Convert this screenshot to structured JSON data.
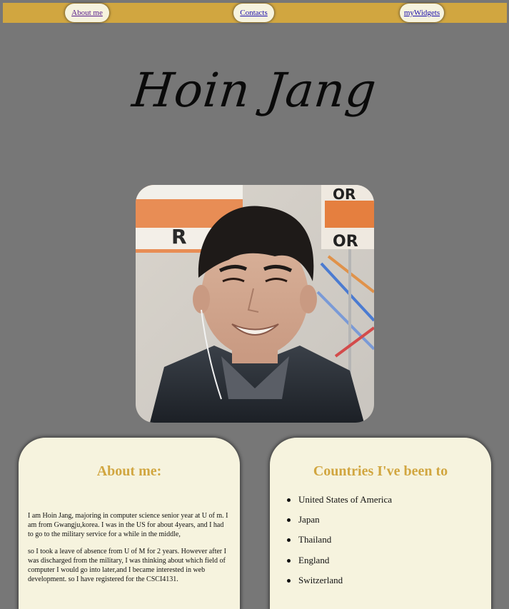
{
  "nav": {
    "about": "About me",
    "contacts": "Contacts",
    "widgets": "myWidgets"
  },
  "header": {
    "name": "Hoin Jang"
  },
  "about": {
    "heading": "About me:",
    "paragraphs": [
      "I am Hoin Jang, majoring in computer science senior year at U of m. I am from Gwangju,korea. I was in the US for about 4years, and I had to go to the military service for a while in the middle,",
      "so I took a leave of absence from U of M for 2 years. However after I was discharged from the military, I was thinking about which field of computer I would go into later,and I became interested in web development. so I have registered for the CSCI4131."
    ]
  },
  "countries": {
    "heading": "Countries I've been to",
    "items": [
      "United States of America",
      "Japan",
      "Thailand",
      "England",
      "Switzerland"
    ]
  },
  "colors": {
    "navbar": "#d1a640",
    "background": "#777777",
    "card": "#f6f3de",
    "heading": "#d1a640"
  }
}
